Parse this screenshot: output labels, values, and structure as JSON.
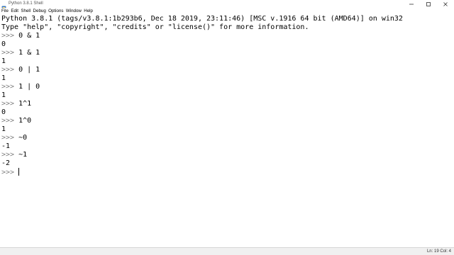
{
  "window": {
    "title": "Python 3.8.1 Shell",
    "icon": "python-idle-icon",
    "controls": [
      "minimize-icon",
      "maximize-icon",
      "close-icon"
    ]
  },
  "menu": {
    "items": [
      {
        "label": "File"
      },
      {
        "label": "Edit"
      },
      {
        "label": "Shell"
      },
      {
        "label": "Debug"
      },
      {
        "label": "Options"
      },
      {
        "label": "Window"
      },
      {
        "label": "Help"
      }
    ]
  },
  "shell": {
    "banner": [
      "Python 3.8.1 (tags/v3.8.1:1b293b6, Dec 18 2019, 23:11:46) [MSC v.1916 64 bit (AMD64)] on win32",
      "Type \"help\", \"copyright\", \"credits\" or \"license()\" for more information."
    ],
    "prompt": ">>> ",
    "entries": [
      {
        "command": "0 & 1",
        "output": "0"
      },
      {
        "command": "1 & 1",
        "output": "1"
      },
      {
        "command": "0 | 1",
        "output": "1"
      },
      {
        "command": "1 | 0",
        "output": "1"
      },
      {
        "command": "1^1",
        "output": "0"
      },
      {
        "command": "1^0",
        "output": "1"
      },
      {
        "command": "~0",
        "output": "-1"
      },
      {
        "command": "~1",
        "output": "-2"
      }
    ],
    "current_input": ""
  },
  "statusbar": {
    "position": "Ln: 19  Col: 4"
  },
  "colors": {
    "prompt": "#808080",
    "text": "#000000",
    "background": "#ffffff",
    "statusbar": "#f0f0f0"
  }
}
